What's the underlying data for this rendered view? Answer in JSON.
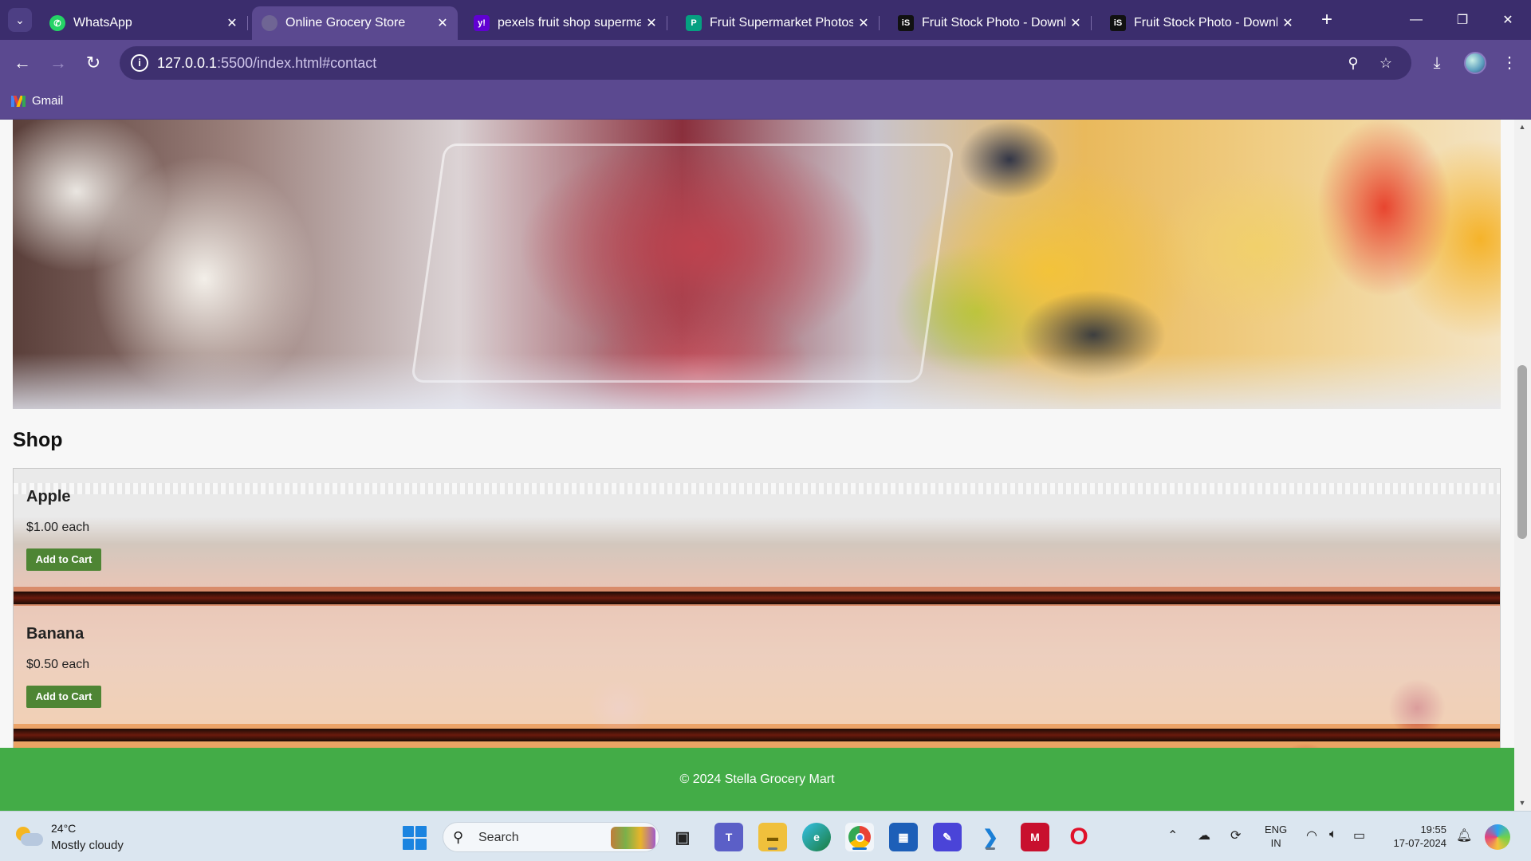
{
  "browser": {
    "tabs": [
      {
        "title": "WhatsApp",
        "active": false
      },
      {
        "title": "Online Grocery Store",
        "active": true
      },
      {
        "title": "pexels fruit shop superma",
        "active": false
      },
      {
        "title": "Fruit Supermarket Photos, I",
        "active": false
      },
      {
        "title": "Fruit Stock Photo - Downlo",
        "active": false
      },
      {
        "title": "Fruit Stock Photo - Downlo",
        "active": false
      }
    ],
    "url_host": "127.0.0.1",
    "url_path": ":5500/index.html#contact",
    "bookmarks": [
      {
        "label": "Gmail"
      }
    ]
  },
  "page": {
    "shop_heading": "Shop",
    "products": [
      {
        "name": "Apple",
        "price": "$1.00 each",
        "button": "Add to Cart"
      },
      {
        "name": "Banana",
        "price": "$0.50 each",
        "button": "Add to Cart"
      }
    ],
    "footer": "© 2024 Stella Grocery Mart"
  },
  "taskbar": {
    "weather_temp": "24°C",
    "weather_condition": "Mostly cloudy",
    "search_label": "Search",
    "language_top": "ENG",
    "language_bottom": "IN",
    "time": "19:55",
    "date": "17-07-2024"
  },
  "colors": {
    "browser_frame": "#3b2d6d",
    "browser_toolbar": "#5b4990",
    "add_to_cart_button": "#4e8534",
    "footer_background": "#43ac47"
  }
}
